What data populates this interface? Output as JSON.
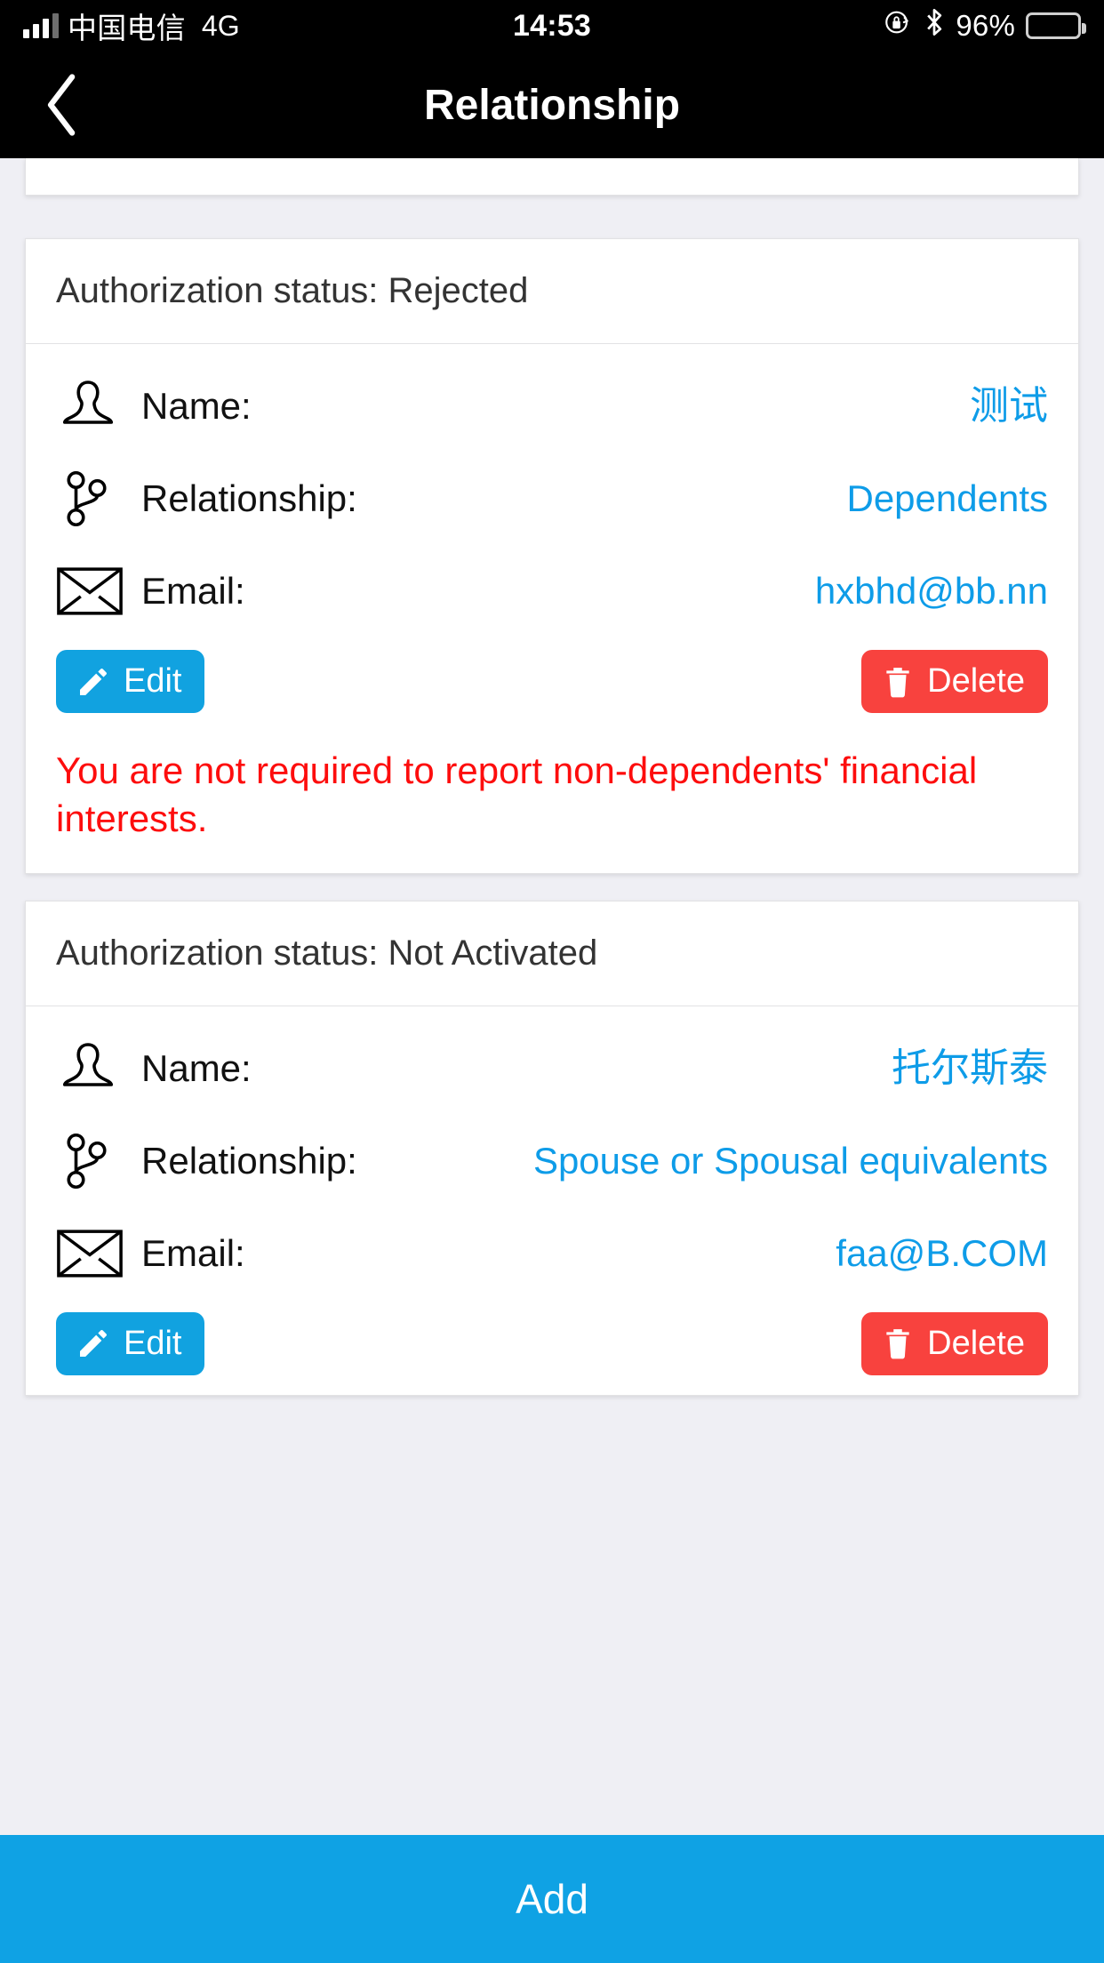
{
  "statusbar": {
    "carrier": "中国电信",
    "network": "4G",
    "time": "14:53",
    "battery_percent": "96%",
    "icons": {
      "signal": "signal-bars-icon",
      "rotation_lock": "rotation-lock-icon",
      "bluetooth": "bluetooth-icon",
      "battery": "battery-icon"
    }
  },
  "navbar": {
    "back_icon": "chevron-left-icon",
    "title": "Relationship"
  },
  "cards": [
    {
      "status_label": "Authorization status: Rejected",
      "rows": [
        {
          "icon": "person-icon",
          "label": "Name:",
          "value": "测试"
        },
        {
          "icon": "relationship-icon",
          "label": "Relationship:",
          "value": "Dependents"
        },
        {
          "icon": "envelope-icon",
          "label": "Email:",
          "value": "hxbhd@bb.nn"
        }
      ],
      "edit_label": "Edit",
      "delete_label": "Delete",
      "warning": "You are not required to report non-dependents' financial interests."
    },
    {
      "status_label": "Authorization status: Not Activated",
      "rows": [
        {
          "icon": "person-icon",
          "label": "Name:",
          "value": "托尔斯泰"
        },
        {
          "icon": "relationship-icon",
          "label": "Relationship:",
          "value": "Spouse or Spousal equivalents"
        },
        {
          "icon": "envelope-icon",
          "label": "Email:",
          "value": "faa@B.COM"
        }
      ],
      "edit_label": "Edit",
      "delete_label": "Delete",
      "warning": ""
    }
  ],
  "bottom_bar": {
    "add_label": "Add"
  },
  "colors": {
    "accent_blue": "#0fa2e4",
    "value_blue": "#0e9ce8",
    "danger_red": "#f8423e",
    "warning_red": "#fd0d0d",
    "page_bg": "#efeff4",
    "bar_black": "#000000"
  }
}
